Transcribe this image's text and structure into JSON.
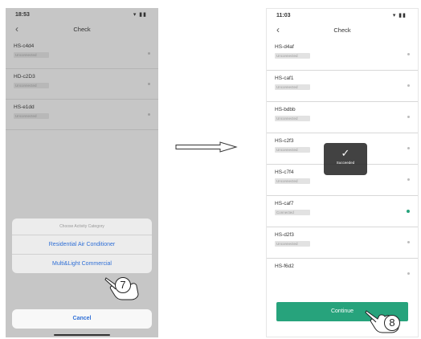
{
  "arrow_icon": "right-arrow-icon",
  "phone1": {
    "status_time": "18:53",
    "status_icons": "▾ ▮▮",
    "back_icon": "chevron-left-icon",
    "title": "Check",
    "devices": [
      {
        "name": "HS-c4d4",
        "tag": "Unconnected"
      },
      {
        "name": "HD-c2D3",
        "tag": "Unconnected"
      },
      {
        "name": "HS-e1dd",
        "tag": "Unconnected"
      }
    ],
    "sheet": {
      "title": "Choose Activity Category",
      "options": [
        "Residential Air Conditioner",
        "Multi&Light Commercial"
      ],
      "cancel": "Cancel"
    },
    "step": "7"
  },
  "phone2": {
    "status_time": "11:03",
    "status_icons": "▾ ▮▮",
    "back_icon": "chevron-left-icon",
    "title": "Check",
    "devices": [
      {
        "name": "HS-d4af",
        "tag": "Unconnected",
        "selected": false
      },
      {
        "name": "HS-caf1",
        "tag": "Unconnected",
        "selected": false
      },
      {
        "name": "HS-bdbb",
        "tag": "Unconnected",
        "selected": false
      },
      {
        "name": "HS-c2f3",
        "tag": "Unconnected",
        "selected": false
      },
      {
        "name": "HS-c7f4",
        "tag": "Unconnected",
        "selected": false
      },
      {
        "name": "HS-caf7",
        "tag": "Connected",
        "selected": true
      },
      {
        "name": "HS-d2f3",
        "tag": "Unconnected",
        "selected": false
      },
      {
        "name": "HS-f6d2",
        "tag": "",
        "selected": false
      }
    ],
    "toast": {
      "icon": "checkmark-icon",
      "message": "Succeeded"
    },
    "continue": "Continue",
    "step": "8"
  },
  "colors": {
    "accent_green": "#27a37c",
    "link_blue": "#2f6fd6",
    "dimmed_bg": "#c6c6c6"
  }
}
